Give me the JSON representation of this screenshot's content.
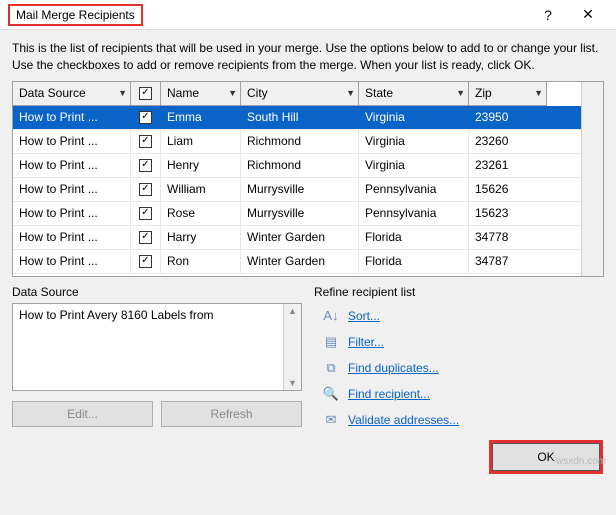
{
  "titlebar": {
    "title": "Mail Merge Recipients",
    "help_symbol": "?",
    "close_symbol": "✕"
  },
  "description": "This is the list of recipients that will be used in your merge.  Use the options below to add to or change your list.  Use the checkboxes to add or remove recipients from the merge.  When your list is ready, click OK.",
  "grid": {
    "headers": {
      "data_source": "Data Source",
      "name": "Name",
      "city": "City",
      "state": "State",
      "zip": "Zip"
    },
    "rows": [
      {
        "ds": "How to Print ...",
        "name": "Emma",
        "city": "South Hill",
        "state": "Virginia",
        "zip": "23950",
        "selected": true
      },
      {
        "ds": "How to Print ...",
        "name": "Liam",
        "city": "Richmond",
        "state": "Virginia",
        "zip": "23260"
      },
      {
        "ds": "How to Print ...",
        "name": "Henry",
        "city": "Richmond",
        "state": "Virginia",
        "zip": "23261"
      },
      {
        "ds": "How to Print ...",
        "name": "William",
        "city": "Murrysville",
        "state": "Pennsylvania",
        "zip": "15626"
      },
      {
        "ds": "How to Print ...",
        "name": "Rose",
        "city": "Murrysville",
        "state": "Pennsylvania",
        "zip": "15623"
      },
      {
        "ds": "How to Print ...",
        "name": "Harry",
        "city": "Winter Garden",
        "state": "Florida",
        "zip": "34778"
      },
      {
        "ds": "How to Print ...",
        "name": "Ron",
        "city": "Winter Garden",
        "state": "Florida",
        "zip": "34787"
      }
    ]
  },
  "data_source_panel": {
    "label": "Data Source",
    "item": "How to Print Avery 8160 Labels from",
    "edit_btn": "Edit...",
    "refresh_btn": "Refresh"
  },
  "refine_panel": {
    "label": "Refine recipient list",
    "sort": "Sort...",
    "filter": "Filter...",
    "find_duplicates": "Find duplicates...",
    "find_recipient": "Find recipient...",
    "validate": "Validate addresses..."
  },
  "footer": {
    "ok": "OK"
  },
  "checkmark": "✓",
  "dropdown_glyph": "▼",
  "watermark": "wsxdn.com"
}
